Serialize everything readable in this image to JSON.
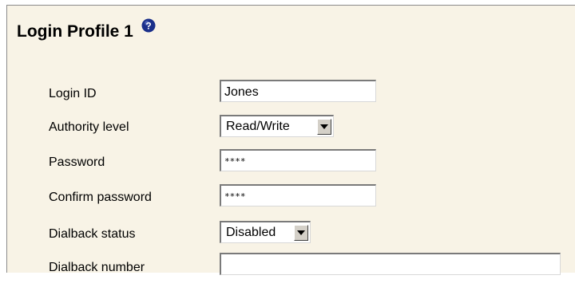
{
  "page": {
    "title": "Login Profile 1",
    "help_icon": "help-question-icon"
  },
  "colors": {
    "panel_background": "#f8f3e6",
    "help_icon_fill": "#1a2f8a"
  },
  "fields": {
    "login_id": {
      "label": "Login ID",
      "value": "Jones"
    },
    "authority_level": {
      "label": "Authority level",
      "selected": "Read/Write",
      "control_icon": "dropdown-arrow-icon"
    },
    "password": {
      "label": "Password",
      "value": "****"
    },
    "confirm_password": {
      "label": "Confirm password",
      "value": "****"
    },
    "dialback_status": {
      "label": "Dialback status",
      "selected": "Disabled",
      "control_icon": "dropdown-arrow-icon"
    },
    "dialback_number": {
      "label": "Dialback number",
      "value": ""
    }
  }
}
